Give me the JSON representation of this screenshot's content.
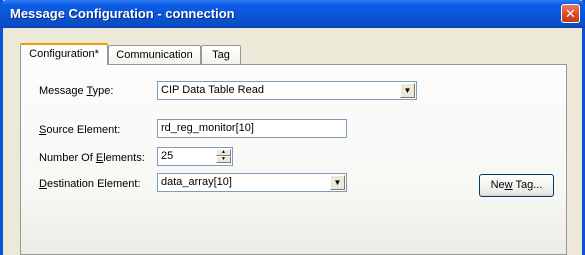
{
  "window": {
    "title": "Message Configuration - connection"
  },
  "tabs": [
    {
      "label": "Configuration*",
      "active": true
    },
    {
      "label": "Communication",
      "active": false
    },
    {
      "label": "Tag",
      "active": false
    }
  ],
  "form": {
    "message_type": {
      "label_before": "Message ",
      "label_accel": "T",
      "label_after": "ype:",
      "value": "CIP Data Table Read"
    },
    "source_element": {
      "label_before": "",
      "label_accel": "S",
      "label_after": "ource Element:",
      "value": "rd_reg_monitor[10]"
    },
    "number_of_elements": {
      "label_before": "Number Of ",
      "label_accel": "E",
      "label_after": "lements:",
      "value": "25"
    },
    "destination_element": {
      "label_before": "",
      "label_accel": "D",
      "label_after": "estination Element:",
      "value": "data_array[10]"
    }
  },
  "buttons": {
    "new_tag": {
      "before": "Ne",
      "accel": "w",
      "after": " Tag..."
    }
  },
  "icons": {
    "close": "close-icon",
    "dropdown": "chevron-down-icon",
    "spin_up": "spin-up-icon",
    "spin_down": "spin-down-icon"
  },
  "colors": {
    "title_bar": "#0a55d9",
    "close_button": "#d84a27",
    "dialog_bg": "#ece9d8",
    "active_tab_accent": "#e8a100"
  }
}
